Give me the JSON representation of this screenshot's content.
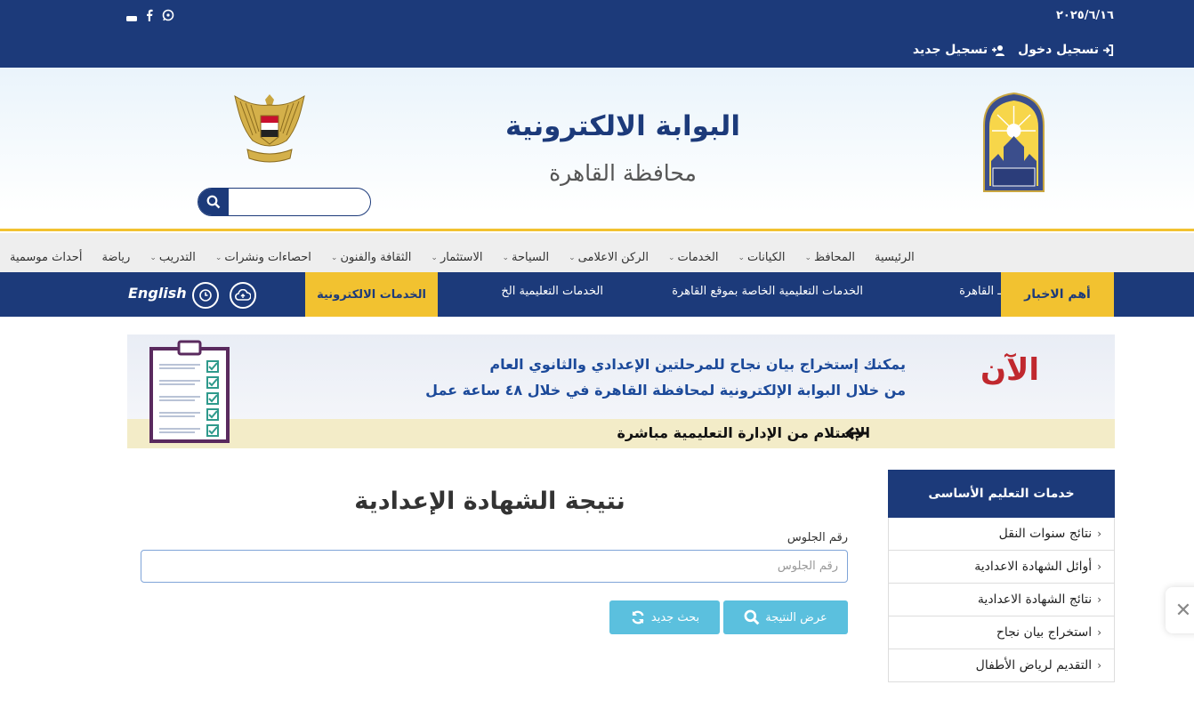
{
  "topbar": {
    "date": "٢٠٢٥/٦/١٦",
    "login": "تسجيل دخول",
    "register": "تسجيل جديد",
    "social_icons": [
      "whatsapp-icon",
      "facebook-icon",
      "youtube-icon"
    ]
  },
  "header": {
    "title": "البوابة الالكترونية",
    "subtitle": "محافظة القاهرة",
    "search_placeholder": ""
  },
  "nav": {
    "items": [
      {
        "label": "الرئيسية",
        "dropdown": false
      },
      {
        "label": "المحافظ",
        "dropdown": true
      },
      {
        "label": "الكيانات",
        "dropdown": true
      },
      {
        "label": "الخدمات",
        "dropdown": true
      },
      {
        "label": "الركن الاعلامى",
        "dropdown": true
      },
      {
        "label": "السياحة",
        "dropdown": true
      },
      {
        "label": "الاستثمار",
        "dropdown": true
      },
      {
        "label": "الثقافة والفنون",
        "dropdown": true
      },
      {
        "label": "احصاءات ونشرات",
        "dropdown": true
      },
      {
        "label": "التدريب",
        "dropdown": true
      },
      {
        "label": "رياضة",
        "dropdown": false
      },
      {
        "label": "أحداث موسمية",
        "dropdown": false
      }
    ]
  },
  "newsbar": {
    "label": "أهم الاخبار",
    "ticker_1": "ـ القاهرة",
    "ticker_2": "الخدمات التعليمية الخاصة بموقع القاهرة",
    "ticker_3": "الخدمات التعليمية الخ",
    "eservices": "الخدمات الالكترونية",
    "english": "English"
  },
  "banner": {
    "now": "الآن",
    "line1": "يمكنك إستخراج بيان نجاح للمرحلتين الإعدادي والثانوي العام",
    "line2": "من خلال البوابة الإلكترونية لمحافظة القاهرة في خلال ٤٨ ساعة عمل",
    "line3": "الإستلام من الإدارة التعليمية مباشرة"
  },
  "sidebar": {
    "title": "خدمات التعليم الأساسى",
    "items": [
      "نتائج سنوات النقل",
      "أوائل الشهادة الاعدادية",
      "نتائج الشهادة الاعدادية",
      "استخراج بيان نجاح",
      "التقديم لرياض الأطفال"
    ]
  },
  "form": {
    "title": "نتيجة الشهادة الإعدادية",
    "seat_label": "رقم الجلوس",
    "seat_placeholder": "رقم الجلوس",
    "show_result": "عرض النتيجة",
    "new_search": "بحث جديد"
  },
  "close_symbol": "✕",
  "colors": {
    "primary": "#1c3a7a",
    "accent": "#f2c230",
    "button": "#5bc0de"
  }
}
